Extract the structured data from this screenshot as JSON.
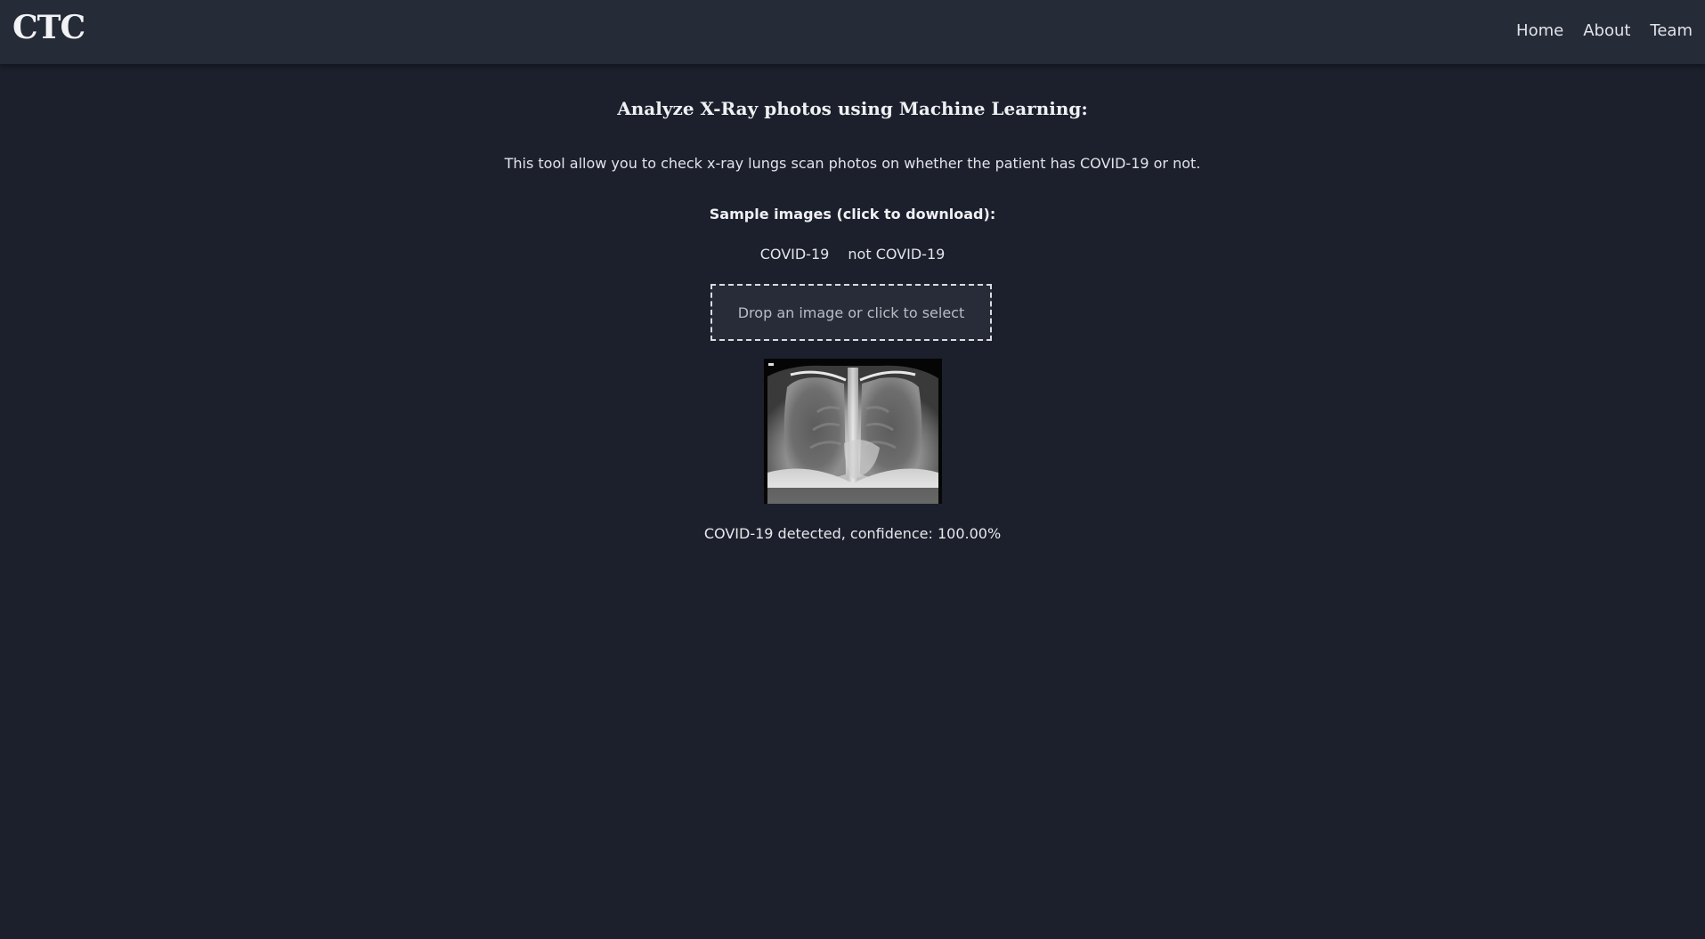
{
  "nav": {
    "brand": "CTC",
    "links": [
      "Home",
      "About",
      "Team"
    ]
  },
  "main": {
    "heading": "Analyze X-Ray photos using Machine Learning:",
    "description": "This tool allow you to check x-ray lungs scan photos on whether the patient has COVID-19 or not.",
    "samples_title": "Sample images (click to download):",
    "samples": [
      "COVID-19",
      "not COVID-19"
    ],
    "dropzone_text": "Drop an image or click to select",
    "result": "COVID-19 detected, confidence: 100.00%"
  },
  "colors": {
    "background": "#1c202c",
    "navbar": "#262b38",
    "text": "#e6e8ec"
  }
}
